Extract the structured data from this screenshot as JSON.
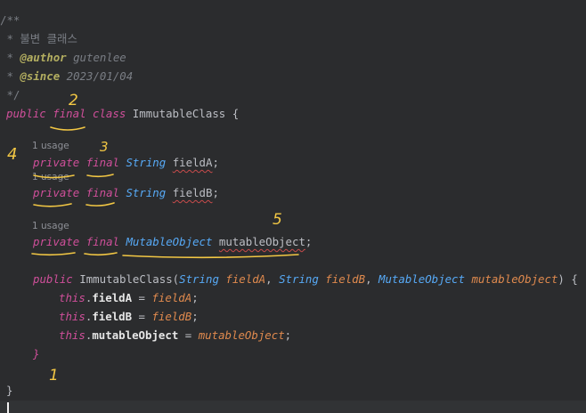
{
  "comment": {
    "open": "/**",
    "line1_star": " * ",
    "line1_text": "불변 클래스",
    "author_star": " * ",
    "author_tag": "@author",
    "author_value": " gutenlee",
    "since_star": " * ",
    "since_tag": "@since",
    "since_value": " 2023/01/04",
    "close": " */"
  },
  "class_decl": {
    "kw_public": "public",
    "kw_final": "final",
    "kw_class": "class",
    "name": "ImmutableClass",
    "brace": "{"
  },
  "usage_hint": "1 usage",
  "fields": [
    {
      "kw1": "private",
      "kw2": "final",
      "type": "String",
      "name": "fieldA",
      "semi": ";"
    },
    {
      "kw1": "private",
      "kw2": "final",
      "type": "String",
      "name": "fieldB",
      "semi": ";"
    },
    {
      "kw1": "private",
      "kw2": "final",
      "type": "MutableObject",
      "name": "mutableObject",
      "semi": ";"
    }
  ],
  "constructor": {
    "kw_public": "public",
    "name": "ImmutableClass",
    "open": "(",
    "p1_type": "String",
    "p1_name": "fieldA",
    "p2_type": "String",
    "p2_name": "fieldB",
    "p3_type": "MutableObject",
    "p3_name": "mutableObject",
    "sep": ", ",
    "close": ") {",
    "body": [
      {
        "this": "this",
        "field": "fieldA",
        "op": " = ",
        "value": "fieldA",
        "semi": ";"
      },
      {
        "this": "this",
        "field": "fieldB",
        "op": " = ",
        "value": "fieldB",
        "semi": ";"
      },
      {
        "this": "this",
        "field": "mutableObject",
        "op": " = ",
        "value": "mutableObject",
        "semi": ";"
      }
    ],
    "end": "}"
  },
  "class_end": "}",
  "annotations": {
    "n1": "1",
    "n2": "2",
    "n3": "3",
    "n4": "4",
    "n5": "5",
    "color": "#f2c744"
  }
}
